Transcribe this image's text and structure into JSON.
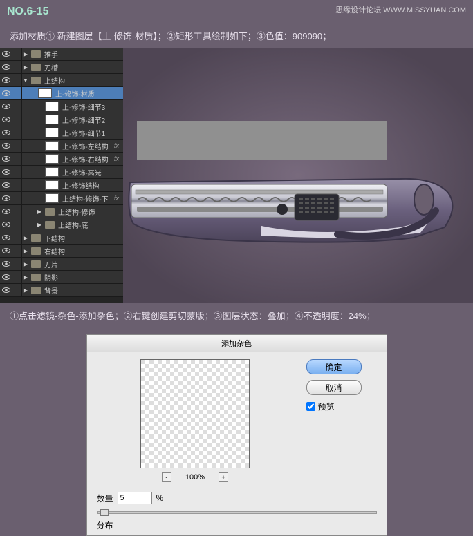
{
  "watermark": "思缘设计论坛  WWW.MISSYUAN.COM",
  "header": {
    "step_no": "NO.6-15"
  },
  "instruction1": "添加材质① 新建图层【上-修饰-材质】；②矩形工具绘制如下；③色值：909090；",
  "instruction2": "①点击滤镜-杂色-添加杂色；②右键创建剪切蒙版；③图层状态：叠加；④不透明度：24%；",
  "layers": [
    {
      "label": "推手",
      "type": "folder",
      "indent": 0,
      "arrow": "▶"
    },
    {
      "label": "刀槽",
      "type": "folder",
      "indent": 0,
      "arrow": "▶"
    },
    {
      "label": "上结构",
      "type": "folder",
      "indent": 0,
      "arrow": "▼"
    },
    {
      "label": "上-修饰-材质",
      "type": "layer",
      "indent": 2,
      "selected": true
    },
    {
      "label": "上-修饰-细节3",
      "type": "layer",
      "indent": 3
    },
    {
      "label": "上-修饰-细节2",
      "type": "layer",
      "indent": 3
    },
    {
      "label": "上-修饰-细节1",
      "type": "layer",
      "indent": 3
    },
    {
      "label": "上-修饰-左结构",
      "type": "layer",
      "indent": 3,
      "fx": true
    },
    {
      "label": "上-修饰-右结构",
      "type": "layer",
      "indent": 3,
      "fx": true
    },
    {
      "label": "上-修饰-高光",
      "type": "layer",
      "indent": 3
    },
    {
      "label": "上-修饰结构",
      "type": "layer",
      "indent": 3
    },
    {
      "label": "上结构-修饰-下",
      "type": "layer",
      "indent": 3,
      "fx": true
    },
    {
      "label": "上结构-修饰",
      "type": "folder",
      "indent": 2,
      "arrow": "▶",
      "underline": true
    },
    {
      "label": "上结构-底",
      "type": "folder",
      "indent": 2,
      "arrow": "▶"
    },
    {
      "label": "下结构",
      "type": "folder",
      "indent": 0,
      "arrow": "▶"
    },
    {
      "label": "右结构",
      "type": "folder",
      "indent": 0,
      "arrow": "▶"
    },
    {
      "label": "刀片",
      "type": "folder",
      "indent": 0,
      "arrow": "▶"
    },
    {
      "label": "阴影",
      "type": "folder",
      "indent": 0,
      "arrow": "▶"
    },
    {
      "label": "背景",
      "type": "folder",
      "indent": 0,
      "arrow": "▶"
    }
  ],
  "dialog": {
    "title": "添加杂色",
    "ok": "确定",
    "cancel": "取消",
    "preview_label": "预览",
    "preview_checked": true,
    "zoom": "100%",
    "amount_label": "数量",
    "amount_value": "5",
    "amount_unit": "%",
    "distribution_label": "分布"
  }
}
